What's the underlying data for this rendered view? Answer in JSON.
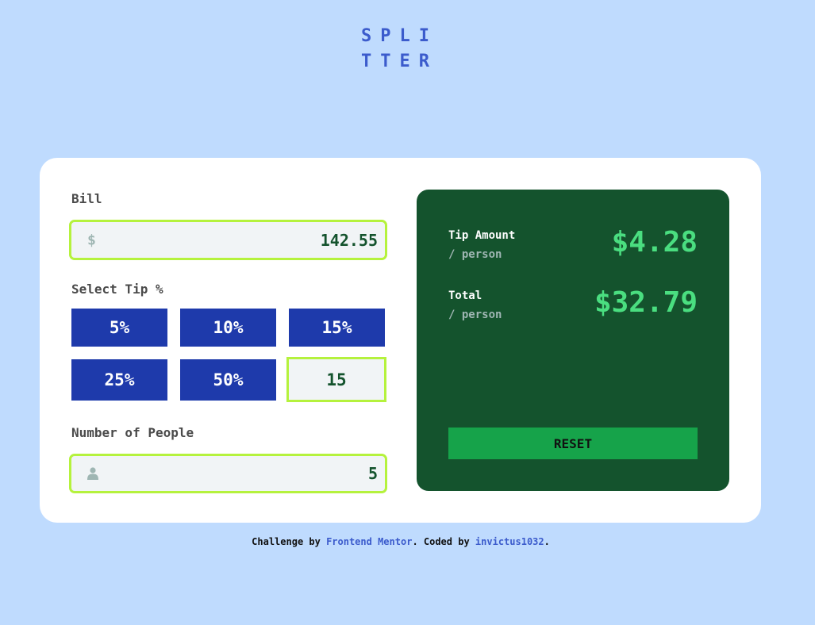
{
  "app": {
    "logo_line1": "SPLI",
    "logo_line2": "TTER"
  },
  "bill": {
    "label": "Bill",
    "currency_icon": "dollar-icon",
    "currency_symbol": "$",
    "value": "142.55"
  },
  "tip": {
    "label": "Select Tip %",
    "options": [
      "5%",
      "10%",
      "15%",
      "25%",
      "50%"
    ],
    "custom_value": "15"
  },
  "people": {
    "label": "Number of People",
    "icon": "person-icon",
    "value": "5"
  },
  "results": {
    "tip_label": "Tip Amount",
    "tip_sub": "/ person",
    "tip_amount": "$4.28",
    "total_label": "Total",
    "total_sub": "/ person",
    "total_amount": "$32.79",
    "reset_label": "RESET"
  },
  "footer": {
    "prefix": "Challenge by ",
    "link1": "Frontend Mentor",
    "middle": ". Coded by ",
    "link2": "invictus1032",
    "suffix": "."
  },
  "colors": {
    "background": "#bfdbfe",
    "accent": "#1e3aab",
    "panel": "#14532d",
    "highlight": "#4ade80",
    "field_border": "#b5f23d",
    "reset": "#16a34a"
  }
}
